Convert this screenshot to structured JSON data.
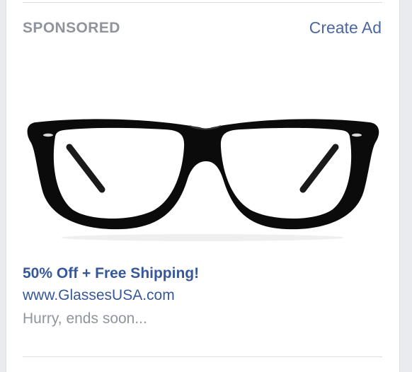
{
  "header": {
    "sponsored_label": "SPONSORED",
    "create_ad_link": "Create Ad"
  },
  "ad": {
    "image_subject": "black-rimmed eyeglasses",
    "headline": "50% Off + Free Shipping!",
    "url": "www.GlassesUSA.com",
    "description": "Hurry, ends soon..."
  },
  "colors": {
    "link": "#365899",
    "muted": "#90949c",
    "divider": "#dddfe2"
  }
}
